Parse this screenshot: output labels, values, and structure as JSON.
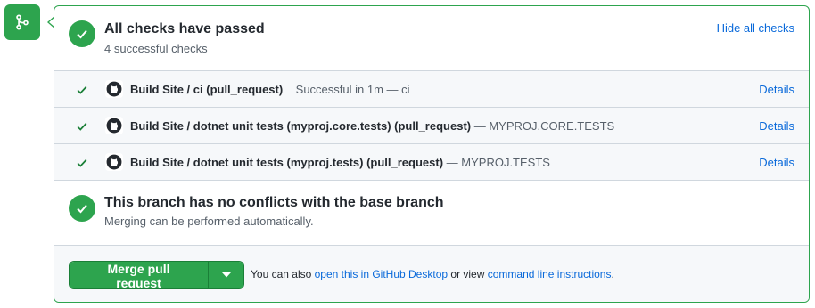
{
  "status": {
    "title": "All checks have passed",
    "subtitle": "4 successful checks",
    "hide_link": "Hide all checks"
  },
  "checks": [
    {
      "name": "Build Site / ci (pull_request)",
      "description": "Successful in 1m — ci",
      "details": "Details"
    },
    {
      "name": "Build Site / dotnet unit tests (myproj.core.tests) (pull_request)",
      "description": "— MYPROJ.CORE.TESTS",
      "details": "Details"
    },
    {
      "name": "Build Site / dotnet unit tests (myproj.tests) (pull_request)",
      "description": "— MYPROJ.TESTS",
      "details": "Details"
    }
  ],
  "merge_status": {
    "title": "This branch has no conflicts with the base branch",
    "subtitle": "Merging can be performed automatically."
  },
  "footer": {
    "merge_button": "Merge pull request",
    "text_prefix": "You can also",
    "desktop_link": "open this in GitHub Desktop",
    "text_middle": "or view",
    "cli_link": "command line instructions",
    "text_suffix": "."
  },
  "colors": {
    "success": "#2da44e",
    "link": "#0969da",
    "border": "#d0d7de"
  }
}
